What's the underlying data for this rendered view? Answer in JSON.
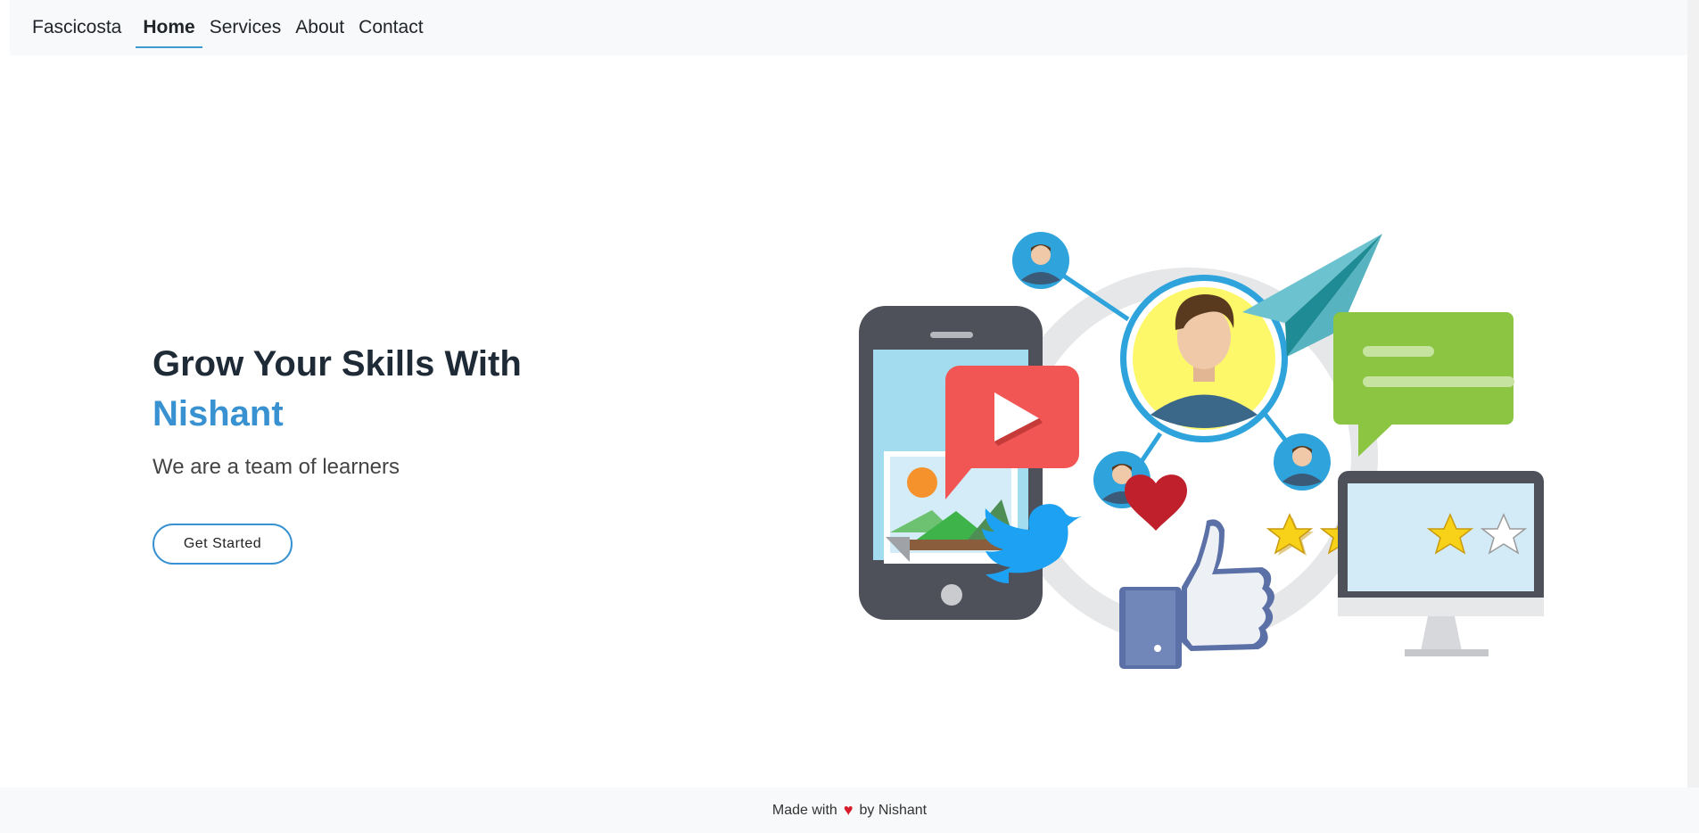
{
  "nav": {
    "brand": "Fascicosta",
    "links": [
      {
        "label": "Home",
        "active": true
      },
      {
        "label": "Services"
      },
      {
        "label": "About"
      },
      {
        "label": "Contact"
      }
    ]
  },
  "hero": {
    "title": "Grow Your Skills With",
    "name": "Nishant",
    "subtitle": "We are a team of learners",
    "cta_label": "Get Started"
  },
  "illustration": {
    "stars_filled": 4,
    "stars_total": 5
  },
  "footer": {
    "prefix": "Made with",
    "heart_icon": "heart-icon",
    "suffix": "by Nishant"
  },
  "colors": {
    "accent": "#3891d0",
    "nav_bg": "#f8f9fa",
    "heart": "#d61b2b"
  }
}
